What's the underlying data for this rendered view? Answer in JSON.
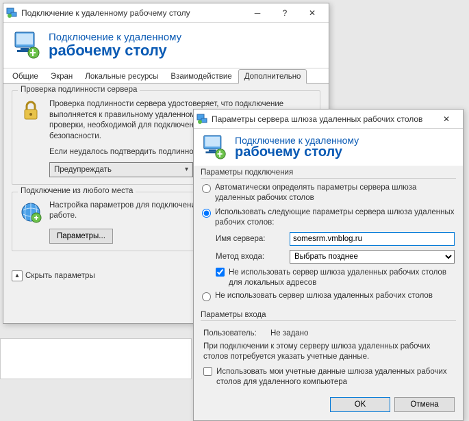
{
  "main_window": {
    "title": "Подключение к удаленному рабочему столу",
    "banner": {
      "line1": "Подключение к удаленному",
      "line2": "рабочему столу"
    },
    "tabs": [
      "Общие",
      "Экран",
      "Локальные ресурсы",
      "Взаимодействие",
      "Дополнительно"
    ],
    "active_tab": 4,
    "group1": {
      "title": "Проверка подлинности сервера",
      "text1": "Проверка подлинности сервера удостоверяет, что подключение выполняется к правильному удаленному компьютеру. Строгость проверки, необходимой для подключения, определяется политикой безопасности.",
      "text2": "Если неудалось подтвердить подлинность удаленного компьютера:",
      "dropdown": "Предупреждать"
    },
    "group2": {
      "title": "Подключение из любого места",
      "text": "Настройка параметров для подключения через шлюз при удаленной работе.",
      "button": "Параметры..."
    },
    "footer_expander": "Скрыть параметры"
  },
  "gateway_window": {
    "title": "Параметры сервера шлюза удаленных рабочих столов",
    "banner": {
      "line1": "Подключение к удаленному",
      "line2": "рабочему столу"
    },
    "conn_section": {
      "title": "Параметры подключения",
      "radio1": "Автоматически определять параметры сервера шлюза удаленных рабочих столов",
      "radio2": "Использовать следующие параметры сервера шлюза удаленных рабочих столов:",
      "server_label": "Имя сервера:",
      "server_value": "somesrm.vmblog.ru",
      "method_label": "Метод входа:",
      "method_value": "Выбрать позднее",
      "check_bypass": "Не использовать сервер шлюза удаленных рабочих столов для локальных адресов",
      "radio3": "Не использовать сервер шлюза удаленных рабочих столов"
    },
    "login_section": {
      "title": "Параметры входа",
      "user_label": "Пользователь:",
      "user_value": "Не задано",
      "hint": "При подключении к этому серверу шлюза удаленных рабочих столов потребуется указать учетные данные.",
      "check_creds": "Использовать мои учетные данные шлюза удаленных рабочих столов для удаленного компьютера"
    },
    "ok": "OK",
    "cancel": "Отмена"
  }
}
